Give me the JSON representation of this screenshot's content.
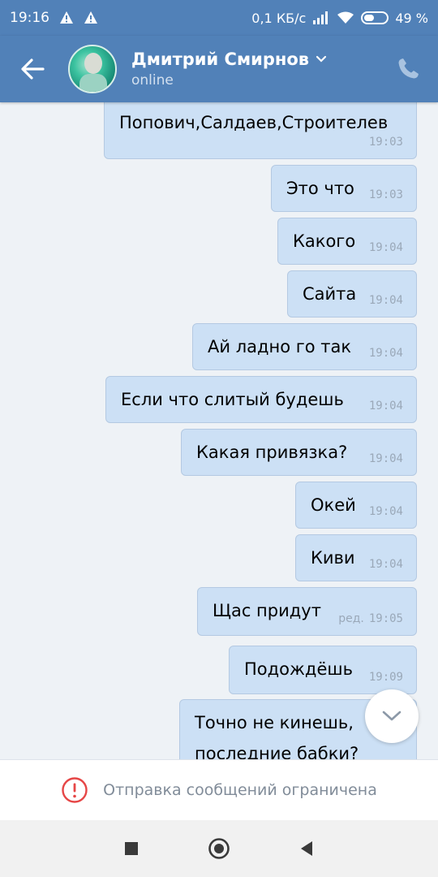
{
  "status_bar": {
    "time": "19:16",
    "network_speed": "0,1 КБ/с",
    "battery": "49 %"
  },
  "header": {
    "contact_name": "Дмитрий Смирнов",
    "presence": "online"
  },
  "messages": [
    {
      "text": "Попович,Салдаев,Строителев",
      "time": "19:03",
      "edited": ""
    },
    {
      "text": "Это что",
      "time": "19:03",
      "edited": ""
    },
    {
      "text": "Какого",
      "time": "19:04",
      "edited": ""
    },
    {
      "text": "Сайта",
      "time": "19:04",
      "edited": ""
    },
    {
      "text": "Ай ладно го так",
      "time": "19:04",
      "edited": ""
    },
    {
      "text": "Если что слитый будешь",
      "time": "19:04",
      "edited": ""
    },
    {
      "text": "Какая привязка?",
      "time": "19:04",
      "edited": ""
    },
    {
      "text": "Окей",
      "time": "19:04",
      "edited": ""
    },
    {
      "text": "Киви",
      "time": "19:04",
      "edited": ""
    },
    {
      "text": "Щас придут",
      "time": "19:05",
      "edited": "ред."
    },
    {
      "text": "Подождёшь",
      "time": "19:09",
      "edited": ""
    },
    {
      "text_line1": "Точно не кинешь,",
      "text_line2": "последние бабки?"
    }
  ],
  "footer": {
    "restriction_notice": "Отправка сообщений ограничена"
  },
  "icons": {
    "back": "arrow-left-icon",
    "call": "phone-icon",
    "chevron": "chevron-down-icon",
    "scroll": "chevron-down-icon",
    "warning": "exclamation-circle-icon"
  },
  "colors": {
    "header_blue": "#5181b8",
    "bubble_out": "#cce0f5",
    "background": "#eef2f6",
    "warning_red": "#e64646"
  }
}
